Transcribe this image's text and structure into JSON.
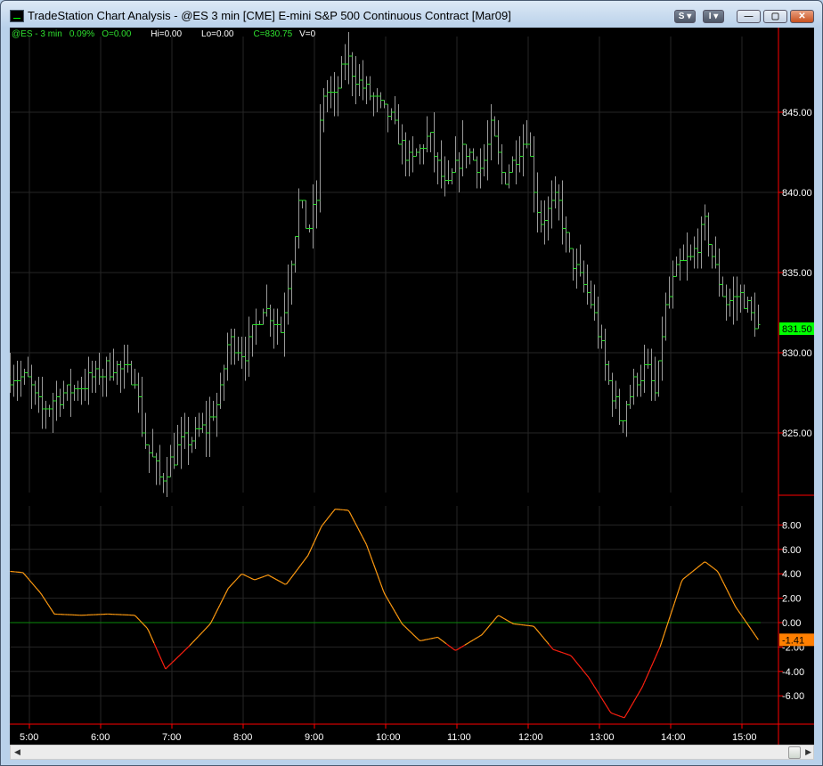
{
  "window": {
    "title": "TradeStation Chart Analysis - @ES  3 min  [CME] E-mini S&P 500 Continuous Contract [Mar09]",
    "buttons": {
      "s": "S ▾",
      "i": "I ▾",
      "minimize": "—",
      "maximize": "▢",
      "close": "✕"
    }
  },
  "info": {
    "symbol": "@ES - 3 min",
    "change": "0.09%",
    "open": "O=0.00",
    "high": "Hi=0.00",
    "low": "Lo=0.00",
    "close": "C=830.75",
    "volume": "V=0"
  },
  "price_axis": {
    "ticks": [
      "845.00",
      "840.00",
      "835.00",
      "830.00",
      "825.00"
    ],
    "current": "831.50",
    "current_value": 831.5,
    "current_color": "#00ff00"
  },
  "osc_axis": {
    "ticks": [
      "8.00",
      "6.00",
      "4.00",
      "2.00",
      "0.00",
      "-2.00",
      "-4.00",
      "-6.00"
    ],
    "current": "-1.41",
    "current_value": -1.41,
    "current_color": "#ff7f00"
  },
  "time_axis": {
    "ticks": [
      "5:00",
      "6:00",
      "7:00",
      "8:00",
      "9:00",
      "10:00",
      "11:00",
      "12:00",
      "13:00",
      "14:00",
      "15:00"
    ]
  },
  "chart_data": [
    {
      "type": "ohlc",
      "title": "@ES 3 min",
      "bar_minutes": 3,
      "ylim": [
        821,
        850
      ],
      "price_anchors_hour_value": [
        [
          4.73,
          828.6
        ],
        [
          4.98,
          828.3
        ],
        [
          5.16,
          826.4
        ],
        [
          5.48,
          827.5
        ],
        [
          5.85,
          828.3
        ],
        [
          6.16,
          829.2
        ],
        [
          6.48,
          828.6
        ],
        [
          6.6,
          824.7
        ],
        [
          6.85,
          822
        ],
        [
          7.1,
          824.2
        ],
        [
          7.48,
          825.3
        ],
        [
          7.66,
          827
        ],
        [
          7.79,
          830.8
        ],
        [
          8.04,
          830
        ],
        [
          8.29,
          833
        ],
        [
          8.54,
          831.4
        ],
        [
          8.66,
          835.3
        ],
        [
          8.79,
          839.7
        ],
        [
          8.91,
          837.5
        ],
        [
          9.04,
          839.7
        ],
        [
          9.1,
          846.4
        ],
        [
          9.29,
          845.8
        ],
        [
          9.45,
          848.6
        ],
        [
          9.6,
          846.9
        ],
        [
          9.85,
          845.8
        ],
        [
          10.1,
          844.4
        ],
        [
          10.35,
          841.7
        ],
        [
          10.6,
          843.6
        ],
        [
          10.85,
          840
        ],
        [
          11.1,
          842.8
        ],
        [
          11.35,
          841.4
        ],
        [
          11.48,
          843.9
        ],
        [
          11.66,
          840.8
        ],
        [
          11.98,
          843.6
        ],
        [
          12.16,
          838
        ],
        [
          12.41,
          839.7
        ],
        [
          12.6,
          835.8
        ],
        [
          12.85,
          833.6
        ],
        [
          12.98,
          831.4
        ],
        [
          13.1,
          828.6
        ],
        [
          13.29,
          825.8
        ],
        [
          13.48,
          828
        ],
        [
          13.66,
          829.2
        ],
        [
          13.79,
          827.2
        ],
        [
          13.91,
          832.5
        ],
        [
          14.1,
          835.3
        ],
        [
          14.29,
          835.8
        ],
        [
          14.48,
          838
        ],
        [
          14.66,
          834.7
        ],
        [
          14.79,
          833
        ],
        [
          14.98,
          833.6
        ],
        [
          15.23,
          831.5
        ]
      ]
    },
    {
      "type": "line",
      "title": "oscillator",
      "ylim": [
        -8,
        10
      ],
      "zero_line": 0,
      "anchors_hour_value": [
        [
          4.73,
          4.2
        ],
        [
          4.91,
          4.1
        ],
        [
          5.16,
          2.4
        ],
        [
          5.35,
          0.7
        ],
        [
          5.73,
          0.6
        ],
        [
          6.1,
          0.7
        ],
        [
          6.48,
          0.6
        ],
        [
          6.66,
          -0.5
        ],
        [
          6.91,
          -3.8
        ],
        [
          7.23,
          -2
        ],
        [
          7.54,
          -0.1
        ],
        [
          7.79,
          2.8
        ],
        [
          7.98,
          4
        ],
        [
          8.16,
          3.5
        ],
        [
          8.35,
          3.9
        ],
        [
          8.6,
          3.1
        ],
        [
          8.91,
          5.5
        ],
        [
          9.1,
          7.9
        ],
        [
          9.29,
          9.3
        ],
        [
          9.48,
          9.2
        ],
        [
          9.73,
          6.4
        ],
        [
          9.98,
          2.4
        ],
        [
          10.23,
          -0.1
        ],
        [
          10.48,
          -1.5
        ],
        [
          10.73,
          -1.2
        ],
        [
          10.98,
          -2.3
        ],
        [
          11.35,
          -1
        ],
        [
          11.58,
          0.6
        ],
        [
          11.79,
          -0.1
        ],
        [
          12.08,
          -0.3
        ],
        [
          12.35,
          -2.2
        ],
        [
          12.6,
          -2.7
        ],
        [
          12.85,
          -4.5
        ],
        [
          13.16,
          -7.4
        ],
        [
          13.35,
          -7.8
        ],
        [
          13.6,
          -5.3
        ],
        [
          13.85,
          -2
        ],
        [
          14.16,
          3.5
        ],
        [
          14.48,
          5
        ],
        [
          14.66,
          4.2
        ],
        [
          14.91,
          1.3
        ],
        [
          15.23,
          -1.41
        ]
      ]
    }
  ]
}
